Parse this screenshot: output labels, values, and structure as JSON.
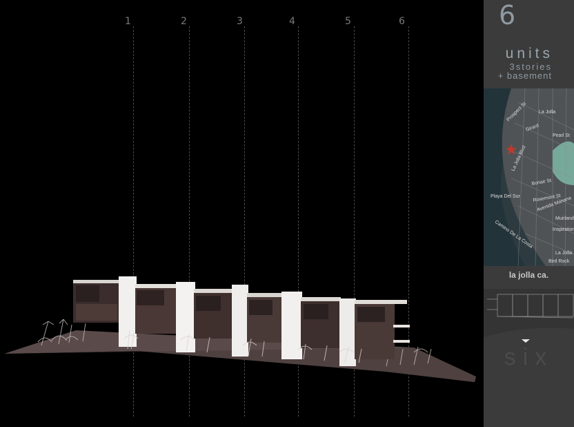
{
  "units": {
    "labels": [
      "1",
      "2",
      "3",
      "4",
      "5",
      "6"
    ]
  },
  "sidebar": {
    "count": "6",
    "units_word": "units",
    "stories": "3stories",
    "basement": "+ basement",
    "location": "la jolla ca.",
    "footer_word": "six"
  },
  "map": {
    "streets": [
      "Prospect St",
      "La Jolla",
      "Girard",
      "Pearl St",
      "La Jolla Blvd",
      "Playa Del Sur",
      "Bonair St",
      "Rosemont St",
      "Avenida Manana",
      "Muirlands",
      "Inspiration",
      "Camino De La Costa",
      "La Jolla",
      "Bird Rock"
    ]
  },
  "colors": {
    "background": "#000000",
    "sidebar": "#3b3b3b",
    "accent": "#9aa6ae"
  }
}
